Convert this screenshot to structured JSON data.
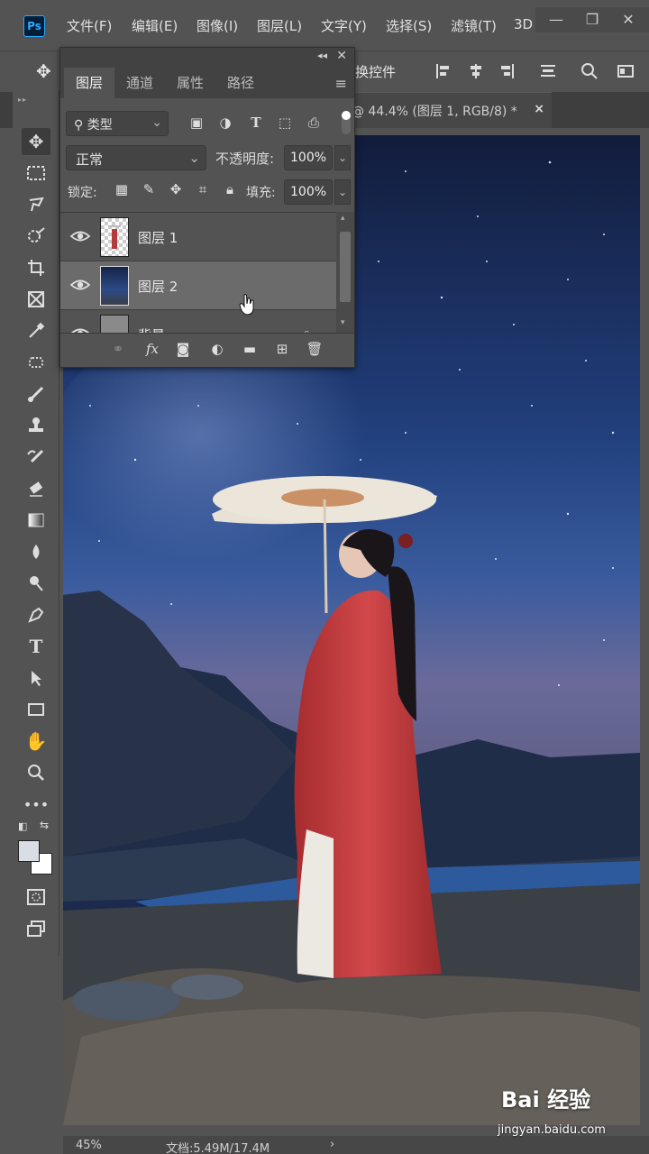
{
  "app": {
    "logo": "Ps"
  },
  "menu": [
    "文件(F)",
    "编辑(E)",
    "图像(I)",
    "图层(L)",
    "文字(Y)",
    "选择(S)",
    "滤镜(T)",
    "3D"
  ],
  "window_controls": {
    "minimize": "—",
    "restore": "❐",
    "close": "✕"
  },
  "options_bar": {
    "transform_label": "换控件"
  },
  "document_tab": {
    "label": "@ 44.4% (图层 1, RGB/8) *",
    "close": "×"
  },
  "layers_panel": {
    "tabs": [
      "图层",
      "通道",
      "属性",
      "路径"
    ],
    "filter": {
      "label": "类型",
      "search_icon": "🔍"
    },
    "blend_mode": "正常",
    "opacity_label": "不透明度:",
    "opacity_value": "100%",
    "lock_label": "锁定:",
    "fill_label": "填充:",
    "fill_value": "100%",
    "layers": [
      {
        "name": "图层 1",
        "visible": true,
        "selected": false
      },
      {
        "name": "图层 2",
        "visible": true,
        "selected": true
      },
      {
        "name": "背景",
        "visible": true,
        "selected": false
      }
    ]
  },
  "status_bar": {
    "zoom": "45%",
    "doc_size": "文档:5.49M/17.4M",
    "arrow": "›"
  },
  "watermark": {
    "brand": "Bai  经验",
    "url": "jingyan.baidu.com"
  },
  "colors": {
    "foreground": "#d9dde6",
    "background": "#ffffff",
    "accent": "#31a8ff"
  }
}
